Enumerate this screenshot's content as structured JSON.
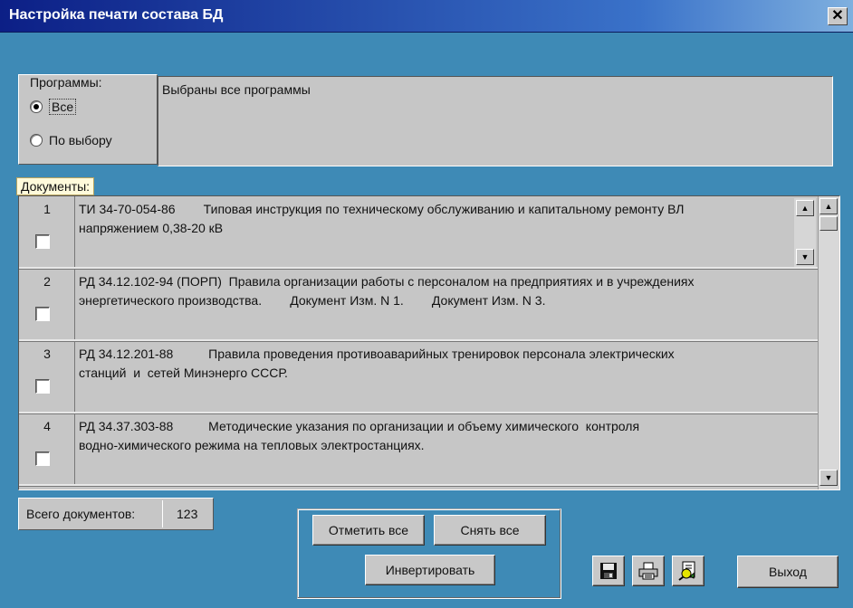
{
  "window": {
    "title": "Настройка печати состава БД",
    "close_glyph": "✕"
  },
  "programs": {
    "group_label": "Программы:",
    "options": [
      {
        "label": "Все",
        "selected": true
      },
      {
        "label": "По выбору",
        "selected": false
      }
    ],
    "summary": "Выбраны все программы"
  },
  "documents": {
    "label": "Документы:",
    "rows": [
      {
        "num": "1",
        "checked": false,
        "text": "ТИ 34-70-054-86        Типовая инструкция по техническому обслуживанию и капитальному ремонту ВЛ\nнапряжением 0,38-20 кВ"
      },
      {
        "num": "2",
        "checked": false,
        "text": "РД 34.12.102-94 (ПОРП)  Правила организации работы с персоналом на предприятиях и в учреждениях\nэнергетического производства.        Документ Изм. N 1.        Документ Изм. N 3."
      },
      {
        "num": "3",
        "checked": false,
        "text": "РД 34.12.201-88          Правила проведения противоаварийных тренировок персонала электрических\nстанций  и  сетей Минэнерго СССР."
      },
      {
        "num": "4",
        "checked": false,
        "text": "РД 34.37.303-88          Методические указания по организации и объему химического  контроля\nводно-химического режима на тепловых электростанциях."
      }
    ]
  },
  "total": {
    "label": "Всего документов:",
    "value": "123"
  },
  "buttons": {
    "select_all": "Отметить все",
    "clear_all": "Снять все",
    "invert": "Инвертировать",
    "exit": "Выход"
  },
  "icons": {
    "save": "save-icon",
    "print": "printer-icon",
    "preview": "preview-icon"
  },
  "colors": {
    "background": "#3e8ab6",
    "panel": "#c6c6c6",
    "title_gradient_start": "#0c1f86",
    "label_highlight": "#fffadb"
  }
}
